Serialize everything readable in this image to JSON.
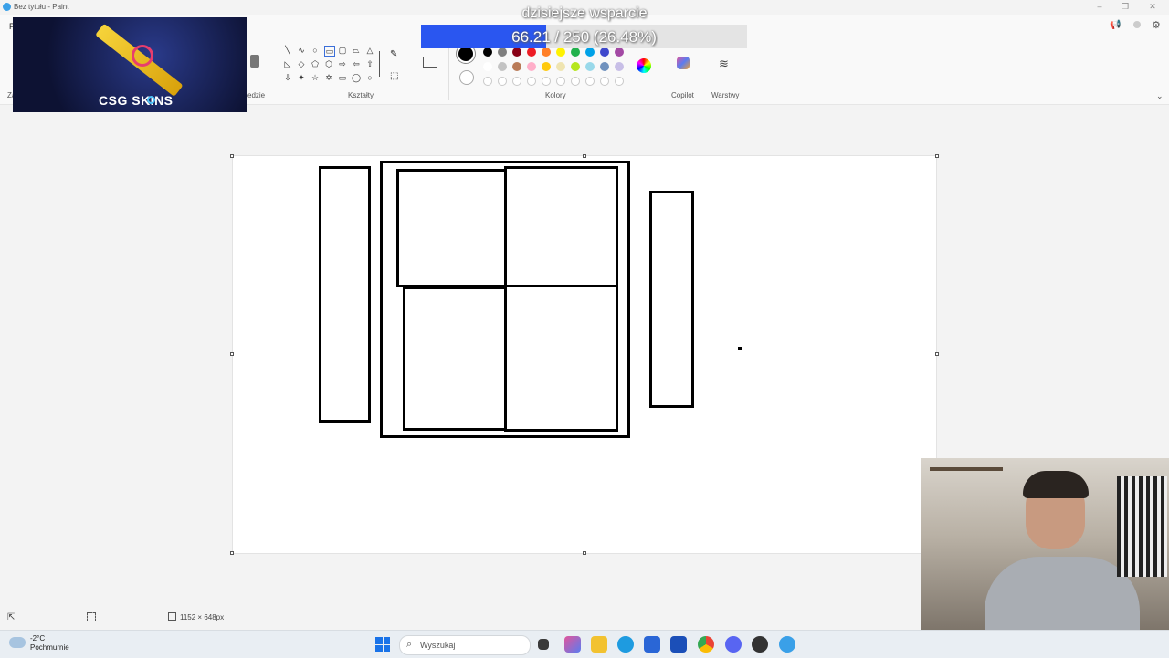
{
  "window": {
    "title": "Bez tytułu - Paint",
    "menu_letter": "P",
    "left_label_1": "Za"
  },
  "ribbon": {
    "groups": {
      "tools_fragment": "edzie",
      "shapes": "Kształty",
      "colors": "Kolory",
      "copilot": "Copilot",
      "layers": "Warstwy"
    }
  },
  "colors": {
    "accent": "#2a56f0",
    "palette_row1": [
      "#000000",
      "#7f7f7f",
      "#880015",
      "#ed1c24",
      "#ff7f27",
      "#fff200",
      "#22b14c",
      "#00a2e8",
      "#3f48cc",
      "#a349a4"
    ],
    "palette_row2": [
      "#ffffff",
      "#c3c3c3",
      "#b97a57",
      "#ffaec9",
      "#ffc90e",
      "#efe4b0",
      "#b5e61d",
      "#99d9ea",
      "#7092be",
      "#c8bfe7"
    ]
  },
  "overlay": {
    "support_title": "dzisiejsze wsparcie",
    "support_progress": "66.21 / 250 (26.48%)",
    "support_fraction": 0.2648,
    "sponsor": "CSG  SKINS"
  },
  "statusbar": {
    "canvas_size": "1152 × 648px"
  },
  "taskbar": {
    "weather_temp": "-2°C",
    "weather_desc": "Pochmurnie",
    "search_placeholder": "Wyszukaj"
  }
}
